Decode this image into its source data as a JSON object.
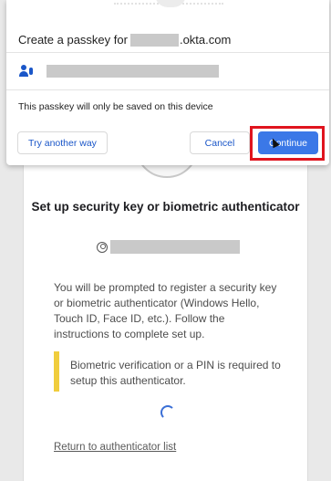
{
  "dialog": {
    "title_prefix": "Create a passkey for",
    "title_suffix": ".okta.com",
    "note": "This passkey will only be saved on this device",
    "buttons": {
      "try_another": "Try another way",
      "cancel": "Cancel",
      "continue": "Continue"
    },
    "account_icon": "user-key-icon"
  },
  "okta": {
    "title": "Set up security key or biometric authenticator",
    "description": "You will be prompted to register a security key or biometric authenticator (Windows Hello, Touch ID, Face ID, etc.). Follow the instructions to complete set up.",
    "notice": "Biometric verification or a PIN is required to setup this authenticator.",
    "return_link": "Return to authenticator list",
    "user_icon": "user-circle-icon",
    "loading_icon": "spinner-icon"
  },
  "colors": {
    "primary": "#3b78e7",
    "link": "#1a56c8",
    "notice_bar": "#f0cd3d",
    "highlight": "#e0141e",
    "redaction": "#c9c9c9"
  }
}
